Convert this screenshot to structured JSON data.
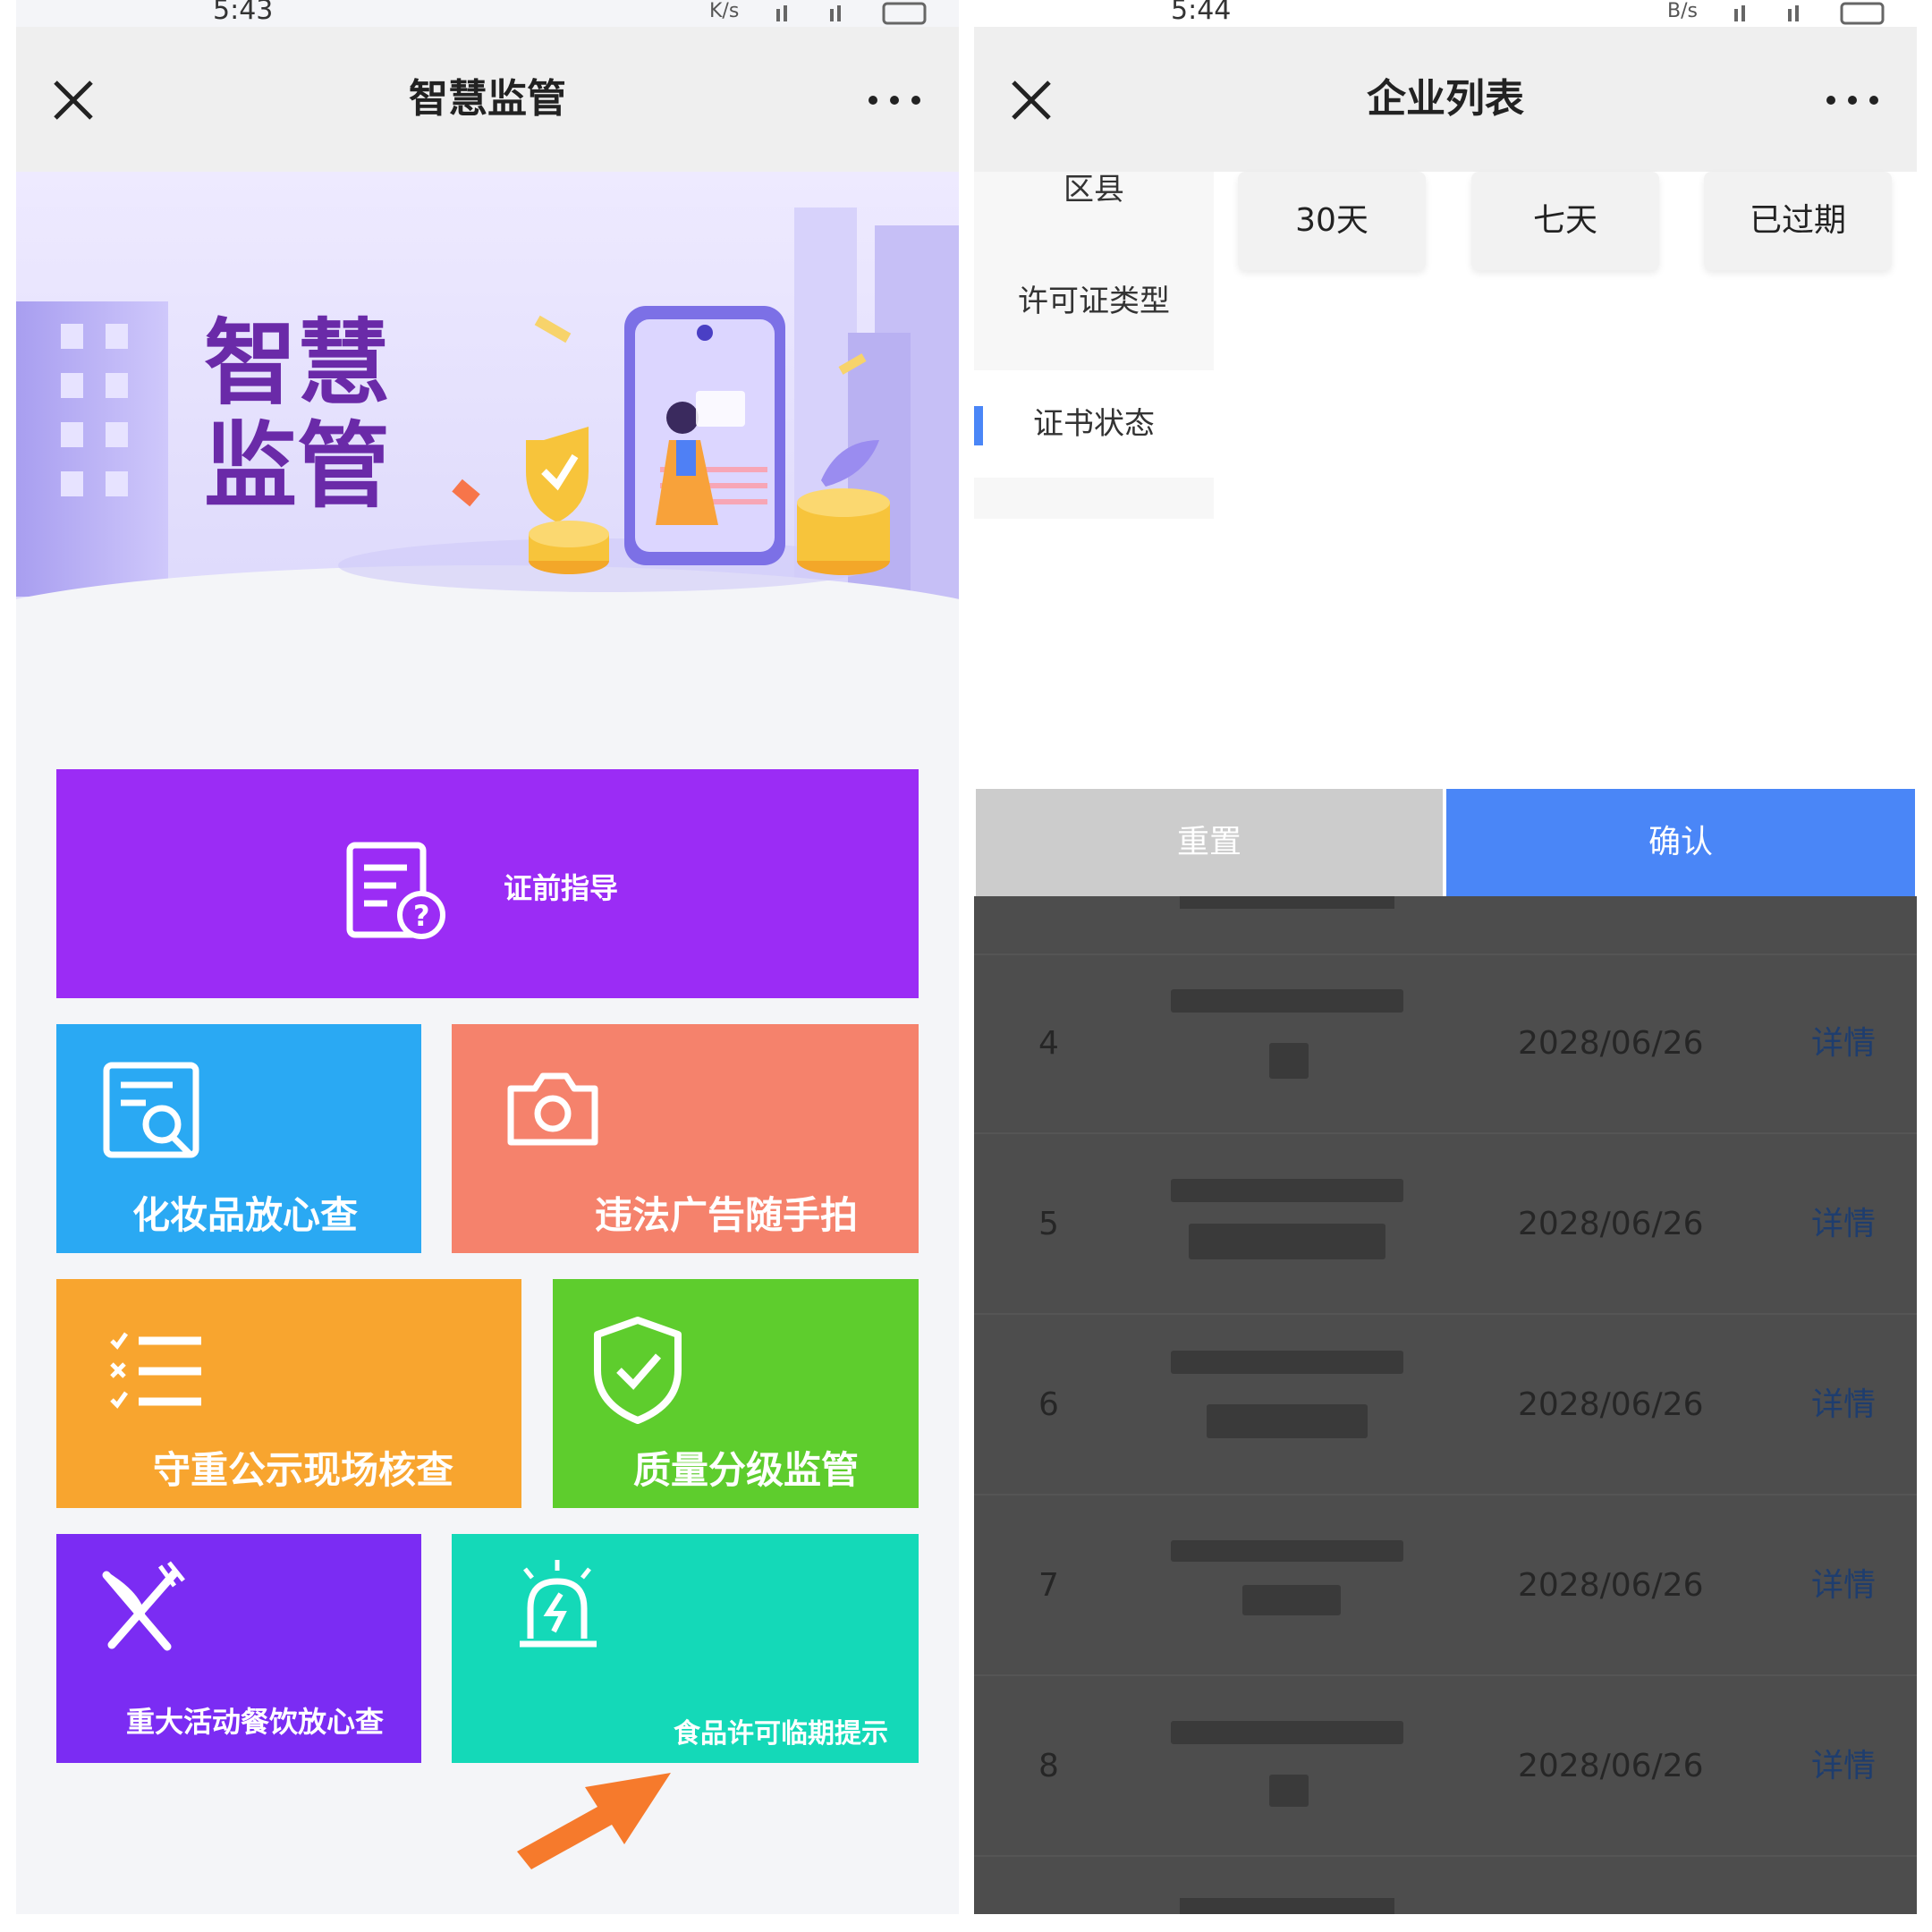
{
  "left_screen": {
    "status_time": "5:43",
    "status_speed": "K/s",
    "nav": {
      "title": "智慧监管"
    },
    "banner": {
      "line1": "智慧",
      "line2": "监管"
    },
    "tiles": [
      {
        "label": "证前指导",
        "icon": "document-question-icon",
        "color": "#9b2cf5"
      },
      {
        "label": "化妆品放心查",
        "icon": "search-document-icon",
        "color": "#2aa9f3"
      },
      {
        "label": "违法广告随手拍",
        "icon": "camera-icon",
        "color": "#f5826c"
      },
      {
        "label": "守重公示现场核查",
        "icon": "checklist-icon",
        "color": "#f8a52f"
      },
      {
        "label": "质量分级监管",
        "icon": "shield-check-icon",
        "color": "#5ecd2d"
      },
      {
        "label": "重大活动餐饮放心查",
        "icon": "fork-knife-icon",
        "color": "#7b2cf3"
      },
      {
        "label": "食品许可临期提示",
        "icon": "alarm-light-icon",
        "color": "#14d9b8"
      }
    ]
  },
  "right_screen": {
    "status_time": "5:44",
    "status_speed": "B/s",
    "nav": {
      "title": "企业列表"
    },
    "filter_categories": [
      "区县",
      "许可证类型",
      "证书状态"
    ],
    "active_category": "证书状态",
    "options": [
      "30天",
      "七天",
      "已过期"
    ],
    "reset_label": "重置",
    "confirm_label": "确认",
    "rows": [
      {
        "index": "4",
        "date": "2028/06/26",
        "action": "详情"
      },
      {
        "index": "5",
        "date": "2028/06/26",
        "action": "详情"
      },
      {
        "index": "6",
        "date": "2028/06/26",
        "action": "详情"
      },
      {
        "index": "7",
        "date": "2028/06/26",
        "action": "详情"
      },
      {
        "index": "8",
        "date": "2028/06/26",
        "action": "详情"
      }
    ],
    "accent_color": "#4a86f7"
  }
}
